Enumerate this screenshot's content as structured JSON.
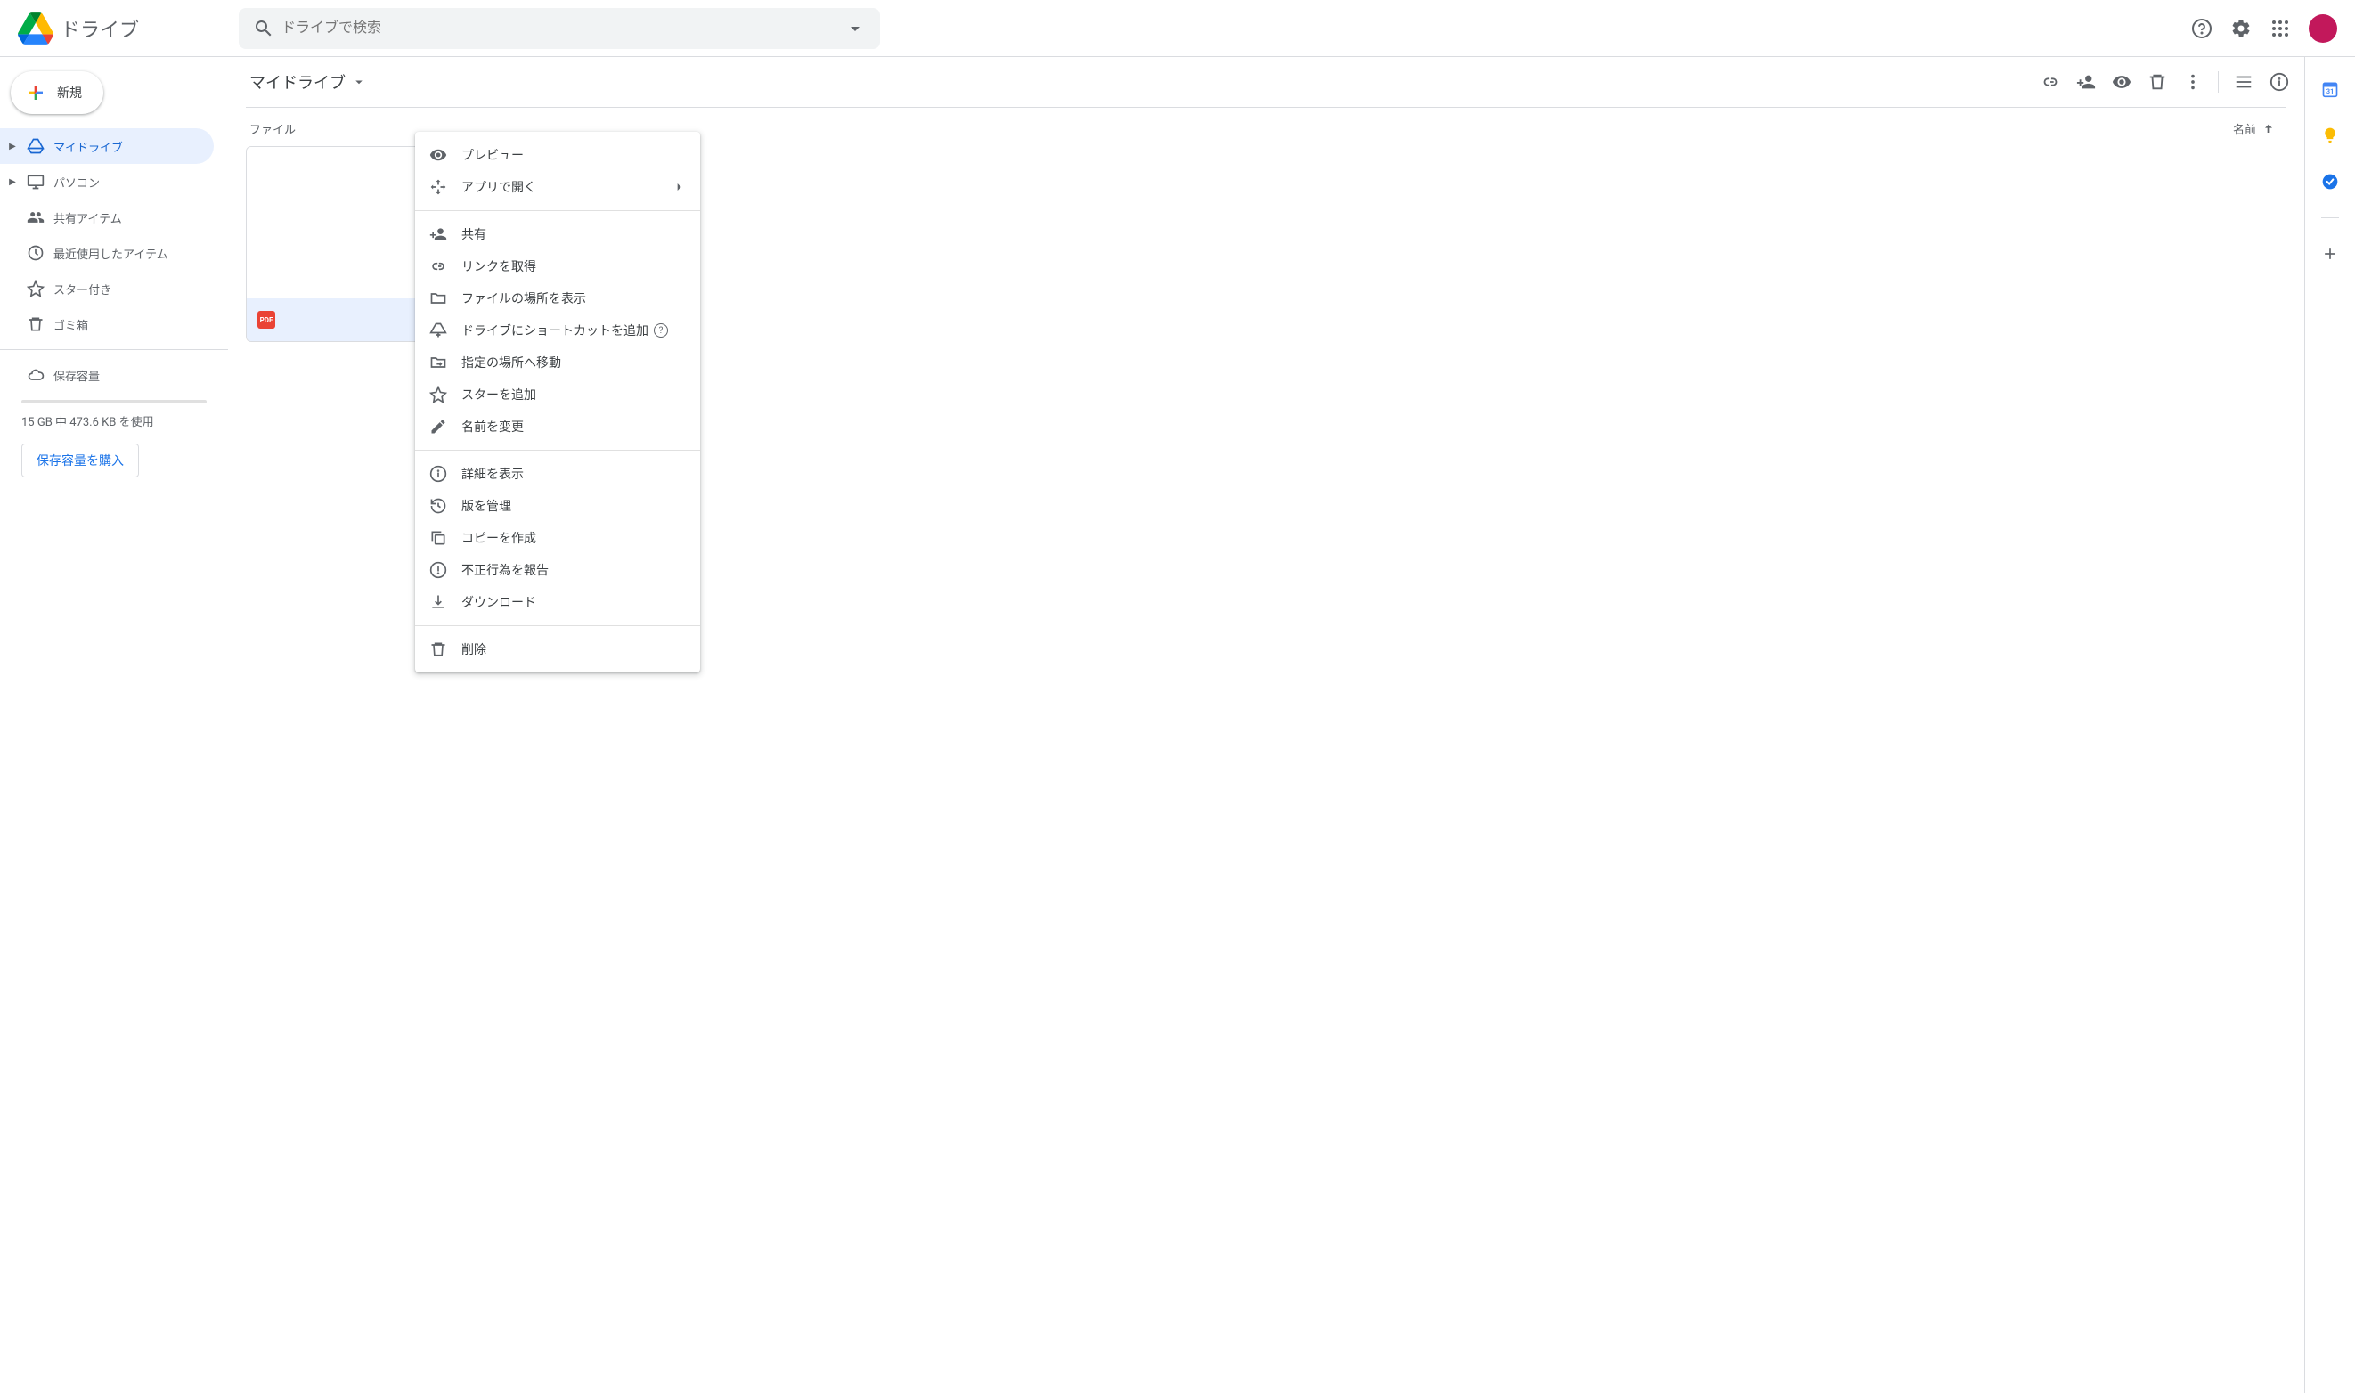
{
  "header": {
    "product_name": "ドライブ",
    "search_placeholder": "ドライブで検索"
  },
  "sidebar": {
    "new_label": "新規",
    "items": [
      {
        "label": "マイドライブ"
      },
      {
        "label": "パソコン"
      },
      {
        "label": "共有アイテム"
      },
      {
        "label": "最近使用したアイテム"
      },
      {
        "label": "スター付き"
      },
      {
        "label": "ゴミ箱"
      }
    ],
    "storage_item_label": "保存容量",
    "storage_text": "15 GB 中 473.6 KB を使用",
    "buy_label": "保存容量を購入"
  },
  "breadcrumb": {
    "title": "マイドライブ"
  },
  "content": {
    "section_label": "ファイル",
    "sort_label": "名前",
    "file_badge": "PDF"
  },
  "context_menu": {
    "groups": [
      [
        {
          "icon": "eye",
          "label": "プレビュー"
        },
        {
          "icon": "openwith",
          "label": "アプリで開く",
          "submenu": true
        }
      ],
      [
        {
          "icon": "personadd",
          "label": "共有"
        },
        {
          "icon": "link",
          "label": "リンクを取得"
        },
        {
          "icon": "folder",
          "label": "ファイルの場所を表示"
        },
        {
          "icon": "shortcut",
          "label": "ドライブにショートカットを追加",
          "help": true
        },
        {
          "icon": "moveto",
          "label": "指定の場所へ移動"
        },
        {
          "icon": "star",
          "label": "スターを追加"
        },
        {
          "icon": "rename",
          "label": "名前を変更"
        }
      ],
      [
        {
          "icon": "info",
          "label": "詳細を表示"
        },
        {
          "icon": "history",
          "label": "版を管理"
        },
        {
          "icon": "copy",
          "label": "コピーを作成"
        },
        {
          "icon": "report",
          "label": "不正行為を報告"
        },
        {
          "icon": "download",
          "label": "ダウンロード"
        }
      ],
      [
        {
          "icon": "trash",
          "label": "削除"
        }
      ]
    ]
  }
}
